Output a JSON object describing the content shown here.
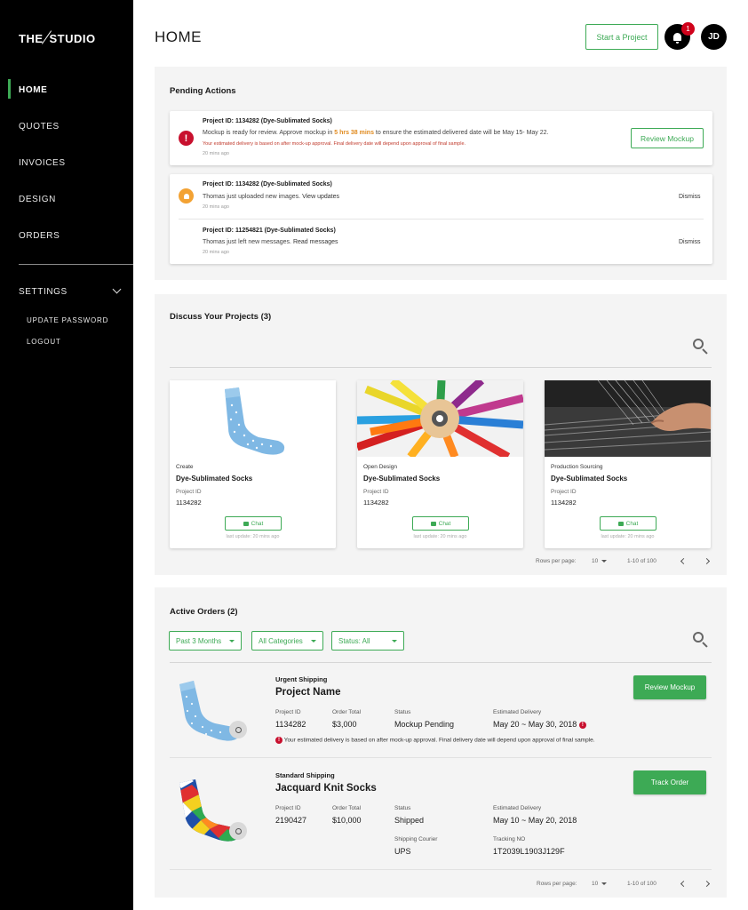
{
  "sidebar": {
    "logo_left": "THE",
    "logo_right": "STUDIO",
    "nav": [
      "HOME",
      "QUOTES",
      "INVOICES",
      "DESIGN",
      "ORDERS"
    ],
    "settings": "SETTINGS",
    "sub": [
      "UPDATE PASSWORD",
      "LOGOUT"
    ]
  },
  "header": {
    "title": "HOME",
    "start_project": "Start a Project",
    "notif_count": "1",
    "avatar": "JD"
  },
  "pending": {
    "title": "Pending Actions",
    "item1": {
      "pid": "Project ID: 1134282 (Dye-Sublimated Socks)",
      "msg_a": "Mockup is ready for review. Approve mockup in ",
      "msg_b": "5 hrs 38 mins",
      "msg_c": " to ensure the estimated delivered date will be May 15- May 22.",
      "warn": "Your estimated delivery is based on after mock-up approval. Final delivery date will depend upon approval of final sample.",
      "ago": "20 mins ago",
      "button": "Review Mockup"
    },
    "item2": {
      "pid": "Project ID: 1134282 (Dye-Sublimated Socks)",
      "msg": "Thomas just uploaded new images.",
      "link": "View updates",
      "ago": "20 mins ago",
      "dismiss": "Dismiss"
    },
    "item3": {
      "pid": "Project ID: 11254821 (Dye-Sublimated Socks)",
      "msg": "Thomas just left new messages.",
      "link": "Read messages",
      "ago": "20 mins ago",
      "dismiss": "Dismiss"
    }
  },
  "discuss": {
    "title": "Discuss Your Projects (3)",
    "projects": [
      {
        "stage": "Create",
        "name": "Dye-Sublimated Socks",
        "id_label": "Project ID",
        "id": "1134282",
        "chat": "Chat",
        "last": "last update: 20 mins ago"
      },
      {
        "stage": "Open Design",
        "name": "Dye-Sublimated Socks",
        "id_label": "Project ID",
        "id": "1134282",
        "chat": "Chat",
        "last": "last update: 20 mins ago"
      },
      {
        "stage": "Production Sourcing",
        "name": "Dye-Sublimated Socks",
        "id_label": "Project ID",
        "id": "1134282",
        "chat": "Chat",
        "last": "last update: 20 mins ago"
      }
    ],
    "rows_label": "Rows per page:",
    "rows_value": "10",
    "range": "1-10 of 100"
  },
  "orders": {
    "title": "Active Orders (2)",
    "filters": [
      "Past 3 Months",
      "All Categories",
      "Status: All"
    ],
    "items": [
      {
        "shipping": "Urgent Shipping",
        "name": "Project Name",
        "pid_label": "Project ID",
        "pid": "1134282",
        "total_label": "Order Total",
        "total": "$3,000",
        "status_label": "Status",
        "status": "Mockup Pending",
        "est_label": "Estimated Delivery",
        "est": "May 20 ~ May 30, 2018",
        "note": "Your estimated delivery is based on after mock-up approval. Final delivery date will depend upon approval of final sample.",
        "button": "Review Mockup"
      },
      {
        "shipping": "Standard Shipping",
        "name": "Jacquard Knit Socks",
        "pid_label": "Project ID",
        "pid": "2190427",
        "total_label": "Order Total",
        "total": "$10,000",
        "status_label": "Status",
        "status": "Shipped",
        "est_label": "Estimated Delivery",
        "est": "May 10 ~ May 20, 2018",
        "courier_label": "Shipping Courier",
        "courier": "UPS",
        "tracking_label": "Tracking NO",
        "tracking": "1T2039L1903J129F",
        "button": "Track Order"
      }
    ],
    "rows_label": "Rows per page:",
    "rows_value": "10",
    "range": "1-10 of 100"
  },
  "colors": {
    "accent": "#3daa55",
    "error": "#c8102e",
    "warning": "#f3a233"
  }
}
